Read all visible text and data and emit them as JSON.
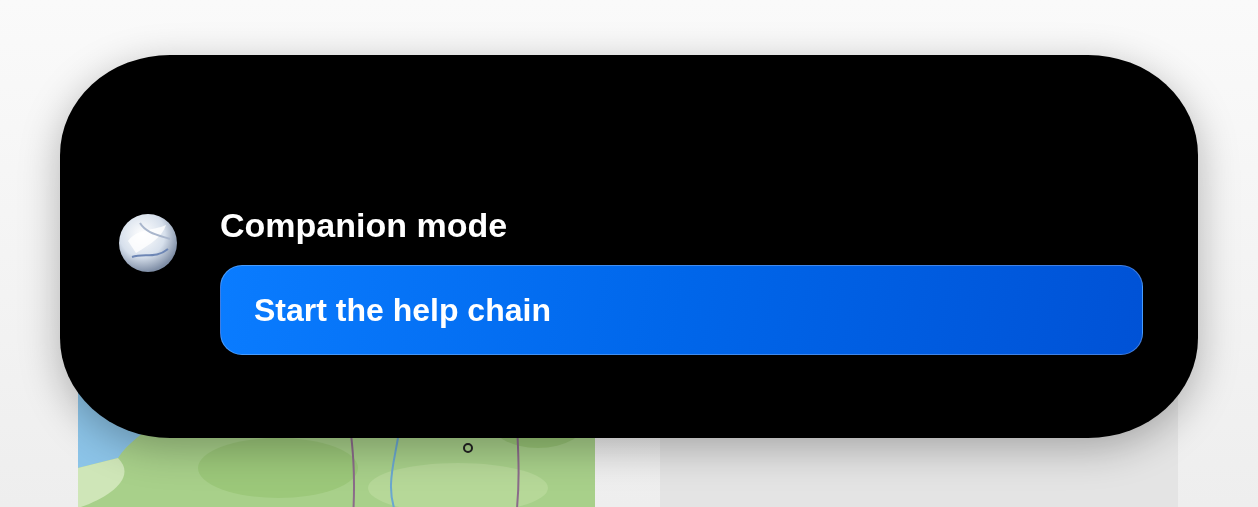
{
  "banner": {
    "title": "Companion mode",
    "button": {
      "label": "Start the help chain"
    }
  }
}
